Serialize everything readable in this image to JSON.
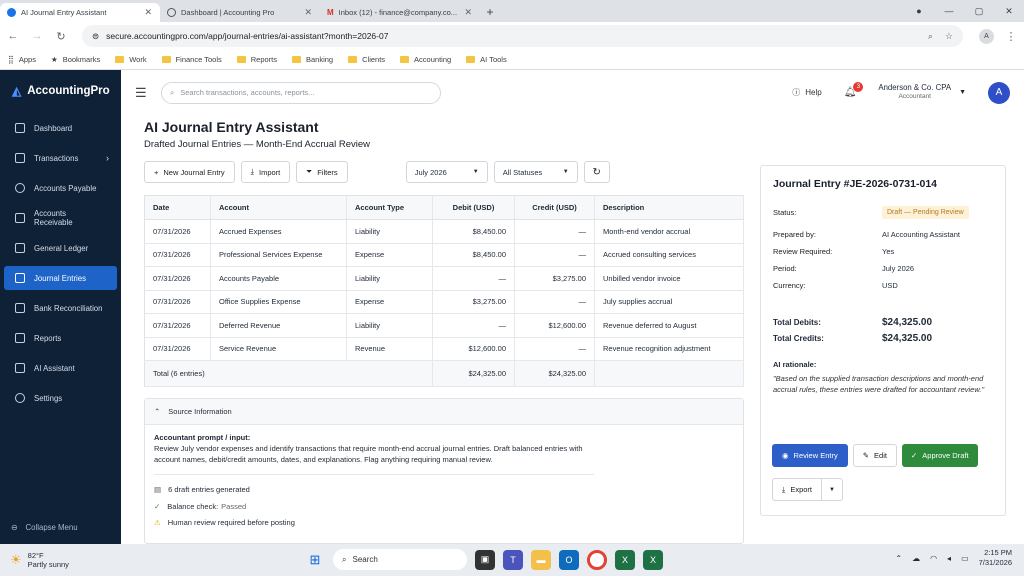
{
  "browser": {
    "tabs": [
      {
        "title": "AI Journal Entry Assistant",
        "active": true
      },
      {
        "title": "Dashboard | Accounting Pro",
        "active": false
      },
      {
        "title": "Inbox (12) - finance@company.co...",
        "active": false
      }
    ],
    "url": "secure.accountingpro.com/app/journal-entries/ai-assistant?month=2026-07",
    "profile_initial": "A",
    "bookmarks": [
      "Apps",
      "Bookmarks",
      "Work",
      "Finance Tools",
      "Reports",
      "Banking",
      "Clients",
      "Accounting",
      "AI Tools"
    ]
  },
  "sidebar": {
    "brand": "AccountingPro",
    "items": [
      {
        "label": "Dashboard"
      },
      {
        "label": "Transactions"
      },
      {
        "label": "Accounts Payable"
      },
      {
        "label": "Accounts Receivable"
      },
      {
        "label": "General Ledger"
      },
      {
        "label": "Journal Entries"
      },
      {
        "label": "Bank Reconciliation"
      },
      {
        "label": "Reports"
      },
      {
        "label": "AI Assistant"
      },
      {
        "label": "Settings"
      }
    ],
    "collapse": "Collapse Menu"
  },
  "header": {
    "search_placeholder": "Search transactions, accounts, reports...",
    "help": "Help",
    "notif_count": "3",
    "company": "Anderson & Co. CPA",
    "role": "Accountant",
    "avatar": "A"
  },
  "page": {
    "title": "AI Journal Entry Assistant",
    "subtitle": "Drafted Journal Entries — Month-End Accrual Review",
    "new_entry": "New Journal Entry",
    "import": "Import",
    "filters": "Filters",
    "period_select": "July 2026",
    "status_select": "All Statuses"
  },
  "table": {
    "headers": [
      "Date",
      "Account",
      "Account Type",
      "Debit (USD)",
      "Credit (USD)",
      "Description"
    ],
    "rows": [
      [
        "07/31/2026",
        "Accrued Expenses",
        "Liability",
        "$8,450.00",
        "—",
        "Month-end vendor accrual"
      ],
      [
        "07/31/2026",
        "Professional Services Expense",
        "Expense",
        "$8,450.00",
        "—",
        "Accrued consulting services"
      ],
      [
        "07/31/2026",
        "Accounts Payable",
        "Liability",
        "—",
        "$3,275.00",
        "Unbilled vendor invoice"
      ],
      [
        "07/31/2026",
        "Office Supplies Expense",
        "Expense",
        "$3,275.00",
        "—",
        "July supplies accrual"
      ],
      [
        "07/31/2026",
        "Deferred Revenue",
        "Liability",
        "—",
        "$12,600.00",
        "Revenue deferred to August"
      ],
      [
        "07/31/2026",
        "Service Revenue",
        "Revenue",
        "$12,600.00",
        "—",
        "Revenue recognition adjustment"
      ]
    ],
    "total_label": "Total (6 entries)",
    "total_debit": "$24,325.00",
    "total_credit": "$24,325.00"
  },
  "source": {
    "header": "Source Information",
    "prompt_label": "Accountant prompt / input:",
    "prompt_text": "Review July vendor expenses and identify transactions that require month-end accrual journal entries. Draft balanced entries with account names, debit/credit amounts, dates, and explanations. Flag anything requiring manual review.",
    "check1": "6 draft entries generated",
    "check2_label": "Balance check:",
    "check2_value": "Passed",
    "check3": "Human review required before posting"
  },
  "panel": {
    "title": "Journal Entry #JE-2026-0731-014",
    "status_label": "Status:",
    "status": "Draft — Pending Review",
    "prepared_label": "Prepared by:",
    "prepared": "AI Accounting Assistant",
    "review_label": "Review Required:",
    "review": "Yes",
    "period_label": "Period:",
    "period": "July 2026",
    "currency_label": "Currency:",
    "currency": "USD",
    "debits_label": "Total Debits:",
    "debits": "$24,325.00",
    "credits_label": "Total Credits:",
    "credits": "$24,325.00",
    "rationale_label": "AI rationale:",
    "rationale": "\"Based on the supplied transaction descriptions and month-end accrual rules, these entries were drafted for accountant review.\"",
    "review_btn": "Review Entry",
    "edit_btn": "Edit",
    "approve_btn": "Approve Draft",
    "export_btn": "Export"
  },
  "taskbar": {
    "temp": "82°F",
    "weather": "Partly sunny",
    "search": "Search",
    "time": "2:15 PM",
    "date": "7/31/2026"
  }
}
